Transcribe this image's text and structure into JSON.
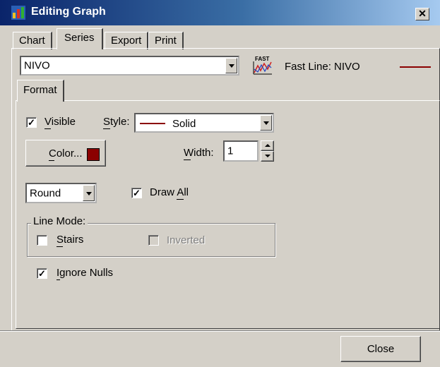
{
  "window": {
    "title": "Editing Graph",
    "close_glyph": "✕"
  },
  "tabs": [
    {
      "label": "Chart"
    },
    {
      "label": "Series",
      "active": true
    },
    {
      "label": "Export"
    },
    {
      "label": "Print"
    }
  ],
  "series_select": {
    "value": "NIVO"
  },
  "series_info": {
    "icon": "fast-line-chart-icon",
    "icon_caption": "FAST",
    "label": "Fast Line: NIVO",
    "line_color": "#8b0000"
  },
  "subtabs": [
    {
      "label": "Format"
    }
  ],
  "format": {
    "visible": {
      "label": "Visible",
      "checked": true
    },
    "style": {
      "label": "Style:",
      "value": "Solid",
      "line_color": "#8b0000"
    },
    "color_button": {
      "label": "Color...",
      "swatch": "#8b0000"
    },
    "width": {
      "label": "Width:",
      "value": "1"
    },
    "join": {
      "value": "Round"
    },
    "draw_all": {
      "label": "Draw All",
      "checked": true
    },
    "line_mode": {
      "legend": "Line Mode:",
      "stairs": {
        "label": "Stairs",
        "checked": false
      },
      "inverted": {
        "label": "Inverted",
        "checked": false,
        "enabled": false
      }
    },
    "ignore_nulls": {
      "label": "Ignore Nulls",
      "checked": true
    }
  },
  "footer": {
    "close_label": "Close"
  }
}
